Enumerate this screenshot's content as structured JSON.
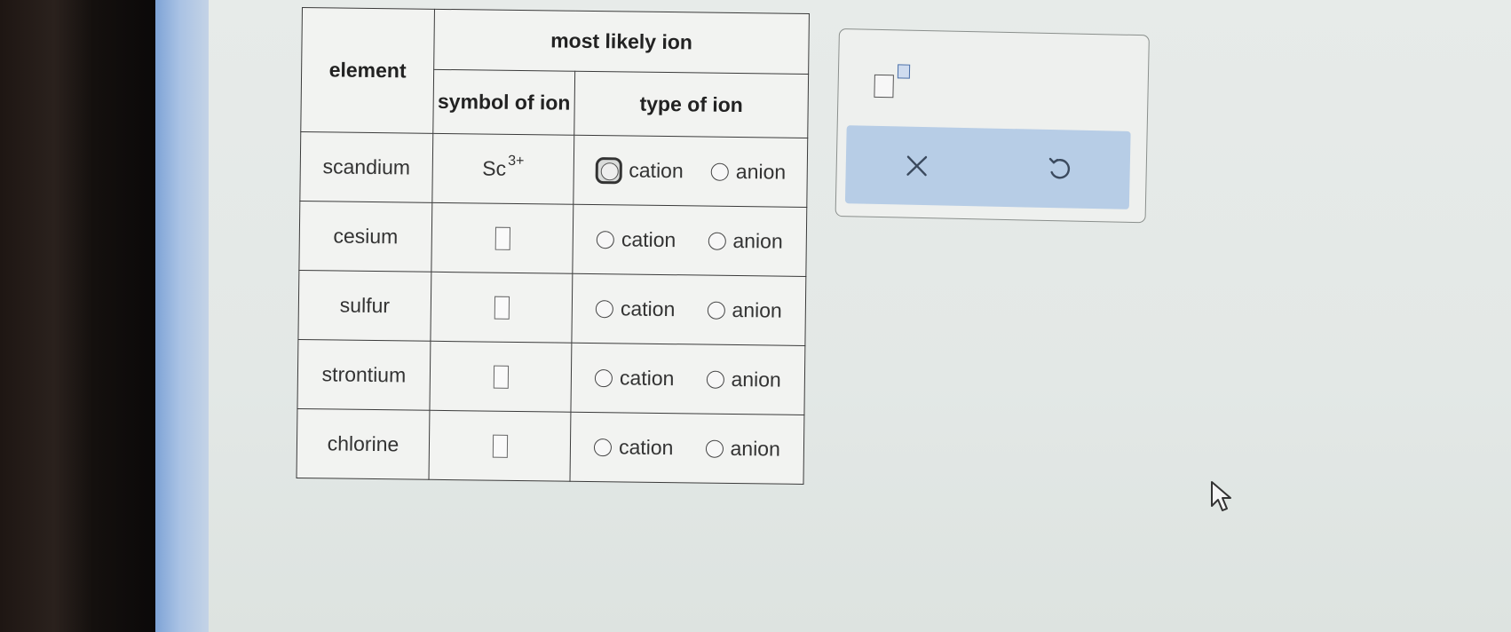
{
  "table": {
    "header": {
      "element": "element",
      "most_likely_ion": "most likely ion",
      "symbol_of_ion": "symbol of ion",
      "type_of_ion": "type of ion"
    },
    "rows": [
      {
        "element": "scandium",
        "symbol_base": "Sc",
        "symbol_charge": "3+",
        "cation": "cation",
        "anion": "anion"
      },
      {
        "element": "cesium",
        "symbol_base": "",
        "symbol_charge": "",
        "cation": "cation",
        "anion": "anion"
      },
      {
        "element": "sulfur",
        "symbol_base": "",
        "symbol_charge": "",
        "cation": "cation",
        "anion": "anion"
      },
      {
        "element": "strontium",
        "symbol_base": "",
        "symbol_charge": "",
        "cation": "cation",
        "anion": "anion"
      },
      {
        "element": "chlorine",
        "symbol_base": "",
        "symbol_charge": "",
        "cation": "cation",
        "anion": "anion"
      }
    ]
  },
  "toolbar": {
    "superscript_icon": "superscript-template-icon",
    "clear_icon": "x-icon",
    "undo_icon": "undo-icon"
  },
  "colors": {
    "action_bar": "#b7cde6",
    "icon_stroke": "#3b4a5e"
  }
}
